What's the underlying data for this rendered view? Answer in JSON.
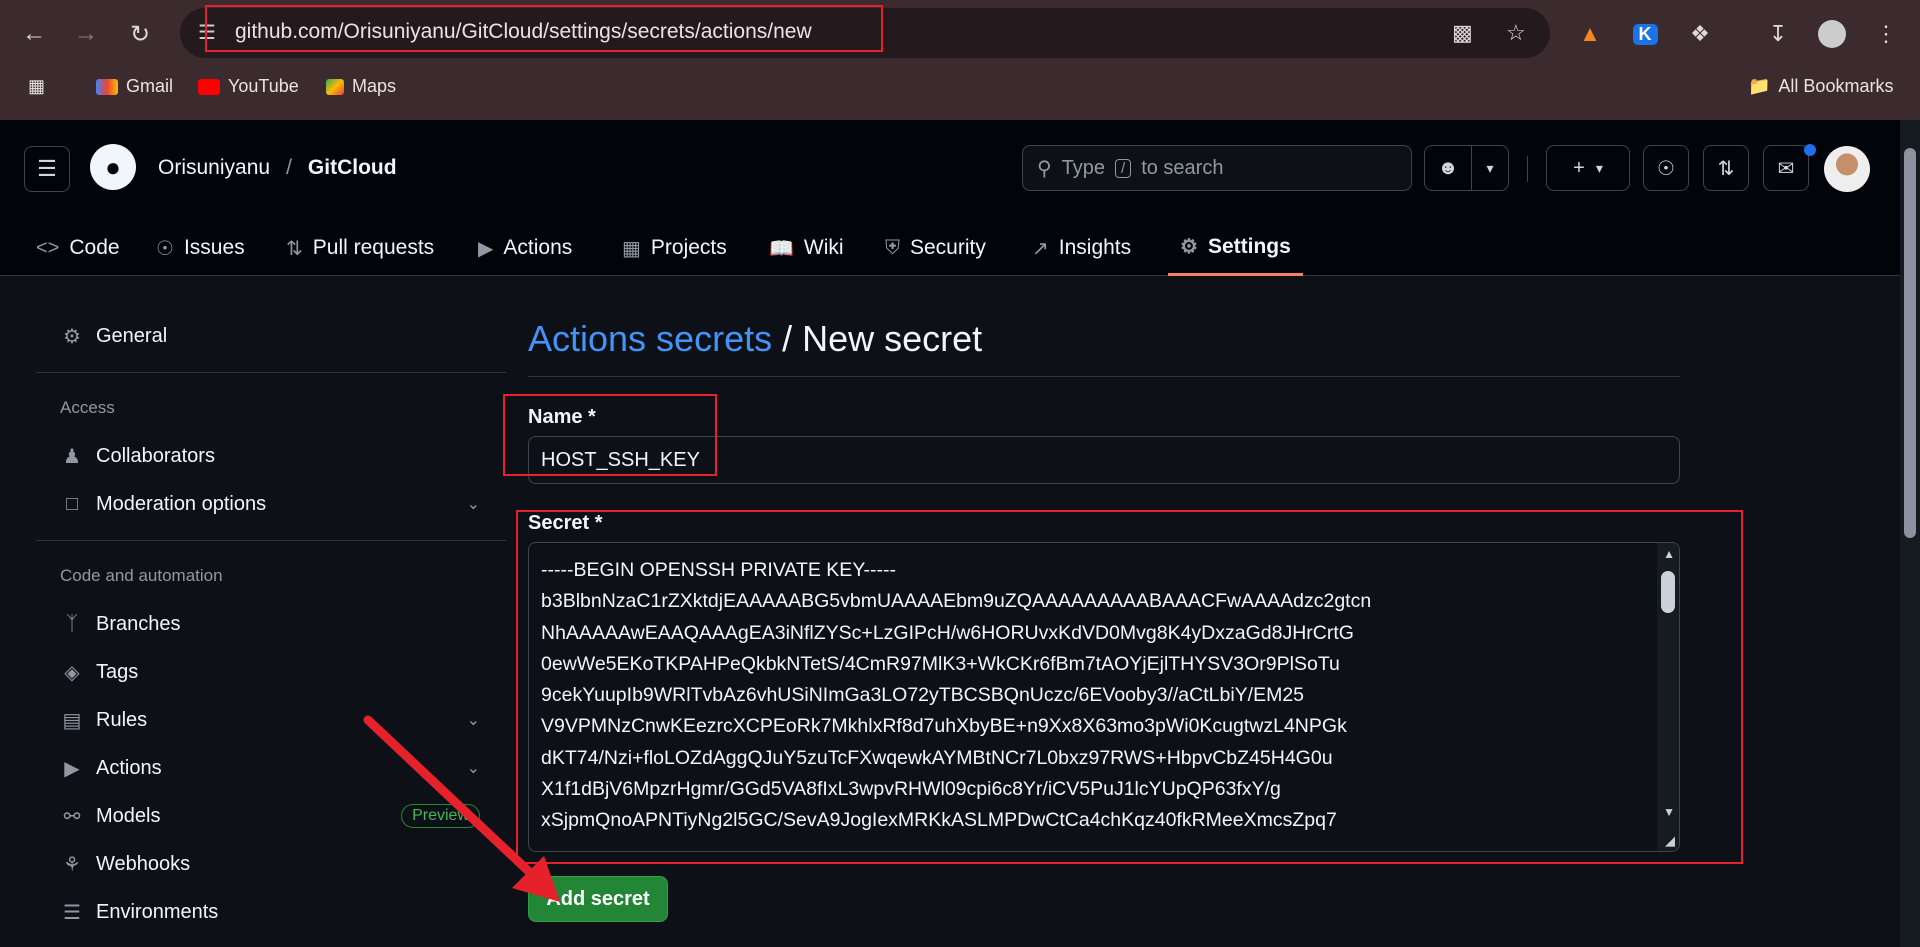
{
  "browser": {
    "url": "github.com/Orisuniyanu/GitCloud/settings/secrets/actions/new",
    "bookmarks": [
      "Gmail",
      "YouTube",
      "Maps"
    ],
    "all_bookmarks": "All Bookmarks"
  },
  "header": {
    "owner": "Orisuniyanu",
    "separator": "/",
    "repo": "GitCloud",
    "search_prefix": "Type",
    "search_key": "/",
    "search_suffix": "to search"
  },
  "repo_tabs": [
    {
      "label": "Code",
      "icon": "code-icon"
    },
    {
      "label": "Issues",
      "icon": "issue-icon"
    },
    {
      "label": "Pull requests",
      "icon": "pull-request-icon"
    },
    {
      "label": "Actions",
      "icon": "play-icon"
    },
    {
      "label": "Projects",
      "icon": "table-icon"
    },
    {
      "label": "Wiki",
      "icon": "book-icon"
    },
    {
      "label": "Security",
      "icon": "shield-icon"
    },
    {
      "label": "Insights",
      "icon": "graph-icon"
    },
    {
      "label": "Settings",
      "icon": "gear-icon",
      "active": true
    }
  ],
  "sidebar": {
    "general": "General",
    "access_heading": "Access",
    "collaborators": "Collaborators",
    "moderation": "Moderation options",
    "code_heading": "Code and automation",
    "branches": "Branches",
    "tags": "Tags",
    "rules": "Rules",
    "actions": "Actions",
    "models": "Models",
    "preview_badge": "Preview",
    "webhooks": "Webhooks",
    "environments": "Environments"
  },
  "main": {
    "title_link": "Actions secrets",
    "title_sep": " / ",
    "title_rest": "New secret",
    "name_label": "Name *",
    "name_value": "HOST_SSH_KEY",
    "secret_label": "Secret *",
    "secret_value": "-----BEGIN OPENSSH PRIVATE KEY-----\nb3BlbnNzaC1rZXktdjEAAAAABG5vbmUAAAAEbm9uZQAAAAAAAAABAAACFwAAAAdzc2gtcn\nNhAAAAAwEAAQAAAgEA3iNflZYSc+LzGIPcH/w6HORUvxKdVD0Mvg8K4yDxzaGd8JHrCrtG\n0ewWe5EKoTKPAHPeQkbkNTetS/4CmR97MlK3+WkCKr6fBm7tAOYjEjlTHYSV3Or9PlSoTu\n9cekYuupIb9WRlTvbAz6vhUSiNImGa3LO72yTBCSBQnUczc/6EVooby3//aCtLbiY/EM25\nV9VPMNzCnwKEezrcXCPEoRk7MkhlxRf8d7uhXbyBE+n9Xx8X63mo3pWi0KcugtwzL4NPGk\ndKT74/Nzi+floLOZdAggQJuY5zuTcFXwqewkAYMBtNCr7L0bxz97RWS+HbpvCbZ45H4G0u\nX1f1dBjV6MpzrHgmr/GGd5VA8fIxL3wpvRHWl09cpi6c8Yr/iCV5PuJ1lcYUpQP63fxY/g\nxSjpmQnoAPNTiyNg2l5GC/SevA9JogIexMRKkASLMPDwCtCa4chKqz40fkRMeeXmcsZpq7",
    "add_button": "Add secret"
  }
}
